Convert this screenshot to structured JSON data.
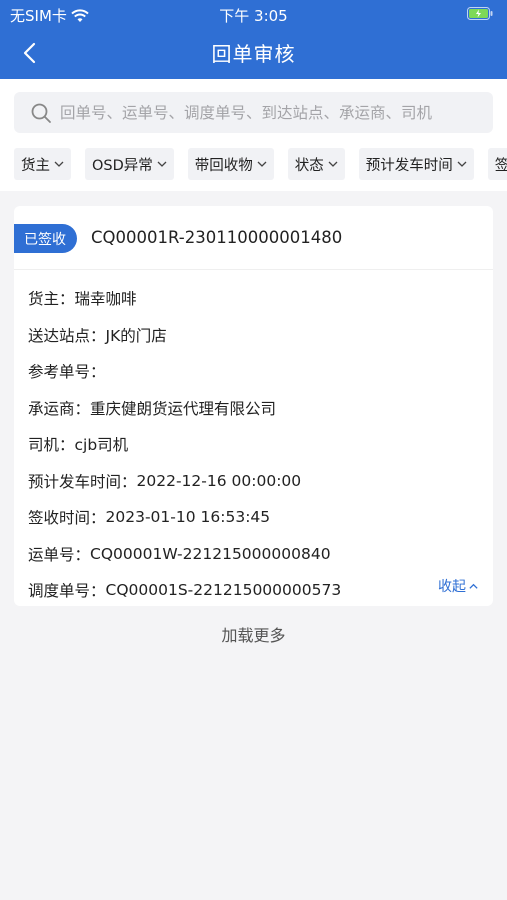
{
  "status_bar": {
    "carrier": "无SIM卡",
    "time": "下午 3:05"
  },
  "nav": {
    "title": "回单审核"
  },
  "search": {
    "placeholder": "回单号、运单号、调度单号、到达站点、承运商、司机"
  },
  "filters": [
    "货主",
    "OSD异常",
    "带回收物",
    "状态",
    "预计发车时间",
    "签"
  ],
  "card": {
    "badge": "已签收",
    "receipt_no": "CQ00001R-230110000001480",
    "fields": [
      {
        "label": "货主：",
        "value": "瑞幸咖啡"
      },
      {
        "label": "送达站点：",
        "value": "JK的门店"
      },
      {
        "label": "参考单号：",
        "value": ""
      },
      {
        "label": "承运商：",
        "value": "重庆健朗货运代理有限公司"
      },
      {
        "label": "司机：",
        "value": "cjb司机"
      },
      {
        "label": "预计发车时间：",
        "value": "2022-12-16 00:00:00"
      },
      {
        "label": "签收时间：",
        "value": "2023-01-10 16:53:45"
      },
      {
        "label": "运单号：",
        "value": "CQ00001W-221215000000840"
      },
      {
        "label": "调度单号：",
        "value": "CQ00001S-221215000000573"
      }
    ],
    "collapse_label": "收起"
  },
  "load_more": "加载更多",
  "colors": {
    "primary": "#2f6fd4",
    "background": "#f4f4f6"
  }
}
